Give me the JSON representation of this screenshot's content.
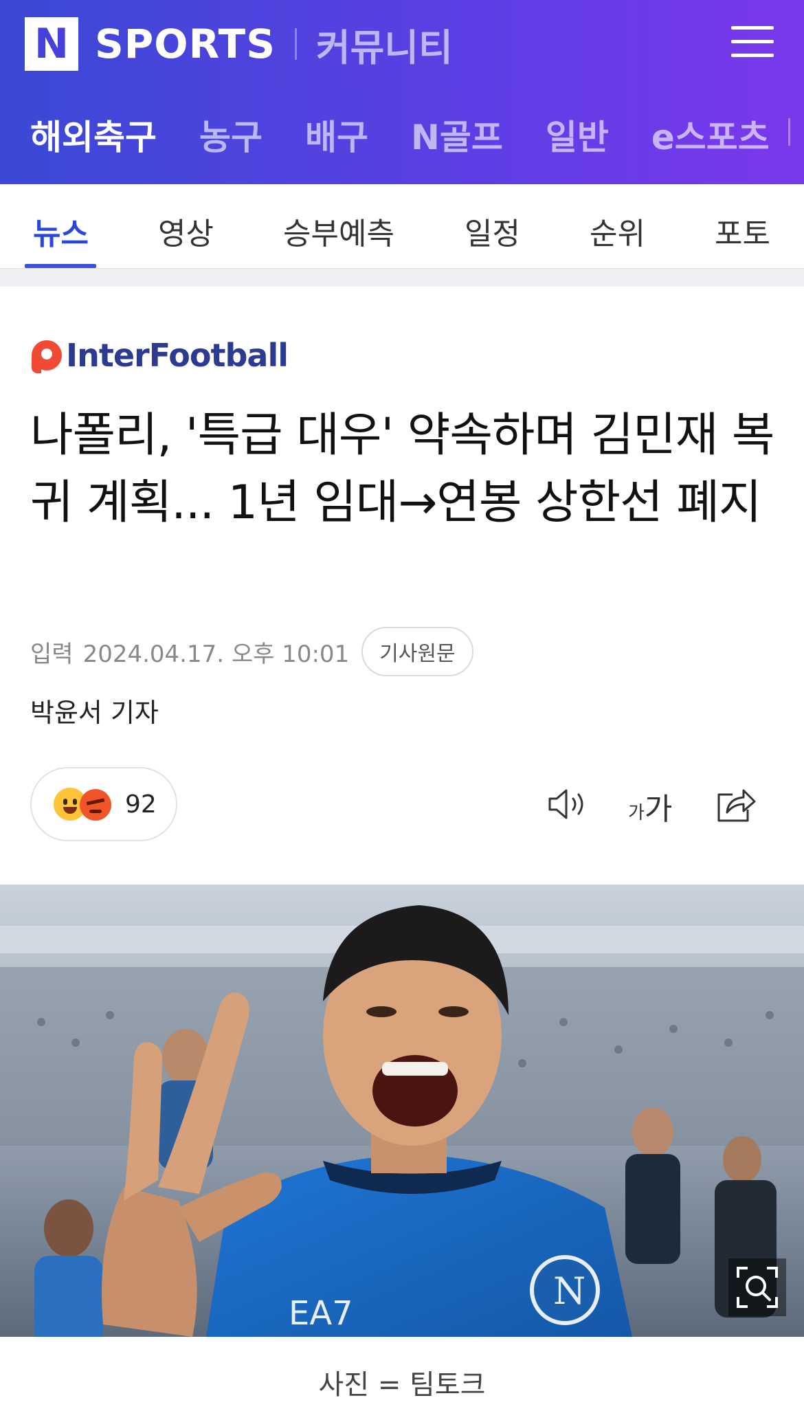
{
  "header": {
    "logo_letter": "N",
    "brand": "SPORTS",
    "community": "커뮤니티",
    "menu_icon": "hamburger-menu-icon"
  },
  "categories": [
    {
      "label": "해외축구",
      "active": true
    },
    {
      "label": "농구",
      "active": false
    },
    {
      "label": "배구",
      "active": false
    },
    {
      "label": "N골프",
      "active": false
    },
    {
      "label": "일반",
      "active": false
    },
    {
      "label": "e스포츠",
      "active": false
    }
  ],
  "tabs": [
    {
      "label": "뉴스",
      "active": true
    },
    {
      "label": "영상",
      "active": false
    },
    {
      "label": "승부예측",
      "active": false
    },
    {
      "label": "일정",
      "active": false
    },
    {
      "label": "순위",
      "active": false
    },
    {
      "label": "포토",
      "active": false
    }
  ],
  "article": {
    "publisher": "InterFootball",
    "headline": "나폴리, '특급 대우' 약속하며 김민재 복귀 계획... 1년 임대→연봉 상한선 폐지",
    "meta_label": "입력",
    "date": "2024.04.17. 오후 10:01",
    "original_button": "기사원문",
    "reporter": "박윤서 기자",
    "reaction_count": "92",
    "font_small": "가",
    "font_big": "가",
    "photo_caption": "사진 = 팀토크"
  },
  "colors": {
    "header_gradient_start": "#3b49d6",
    "header_gradient_end": "#7a38ec",
    "active_tab": "#2b47d9",
    "publisher_red": "#f04a34"
  }
}
